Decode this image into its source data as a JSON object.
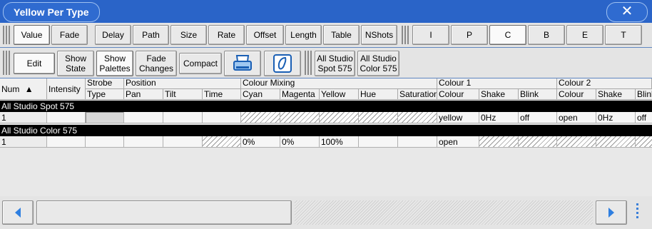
{
  "window": {
    "title": "Yellow Per Type",
    "close_glyph": "✕"
  },
  "toolbar1": {
    "buttons": [
      "Value",
      "Fade",
      "Delay",
      "Path",
      "Size",
      "Rate",
      "Offset",
      "Length",
      "Table",
      "NShots"
    ],
    "selected": "Value",
    "attribute_buttons": [
      "I",
      "P",
      "C",
      "B",
      "E",
      "T"
    ],
    "attribute_selected": "C"
  },
  "toolbar2": {
    "edit": "Edit",
    "show_state": [
      "Show",
      "State"
    ],
    "show_palettes": [
      "Show",
      "Palettes"
    ],
    "fade_changes": [
      "Fade",
      "Changes"
    ],
    "compact": "Compact",
    "print_icon": "printer-icon",
    "palette_icon": "palette-icon",
    "fixture_buttons": [
      {
        "line1": "All Studio",
        "line2": "Spot 575"
      },
      {
        "line1": "All Studio",
        "line2": "Color 575"
      }
    ]
  },
  "table": {
    "groups": {
      "strobe": "Strobe",
      "position": "Position",
      "colour_mixing": "Colour Mixing",
      "colour1": "Colour 1",
      "colour2": "Colour 2"
    },
    "columns": {
      "num": "Num",
      "intensity": "Intensity",
      "type": "Type",
      "pan": "Pan",
      "tilt": "Tilt",
      "time": "Time",
      "cyan": "Cyan",
      "magenta": "Magenta",
      "yellow": "Yellow",
      "hue": "Hue",
      "saturation": "Saturation",
      "colour": "Colour",
      "shake": "Shake",
      "blink": "Blink",
      "colour2": "Colour",
      "shake2": "Shake",
      "blink2": "Blink"
    },
    "sort_indicator": "▲",
    "group_rows": [
      "All Studio Spot 575",
      "All Studio Color 575"
    ],
    "spot_row": {
      "num": "1",
      "colour": "yellow",
      "shake": "0Hz",
      "blink": "off",
      "colour2": "open",
      "shake2": "0Hz",
      "blink2": "off"
    },
    "color_row": {
      "num": "1",
      "cyan": "0%",
      "magenta": "0%",
      "yellow": "100%",
      "colour": "open"
    }
  },
  "colors": {
    "titlebar": "#2a64c8",
    "accent": "#3a7fd9"
  }
}
